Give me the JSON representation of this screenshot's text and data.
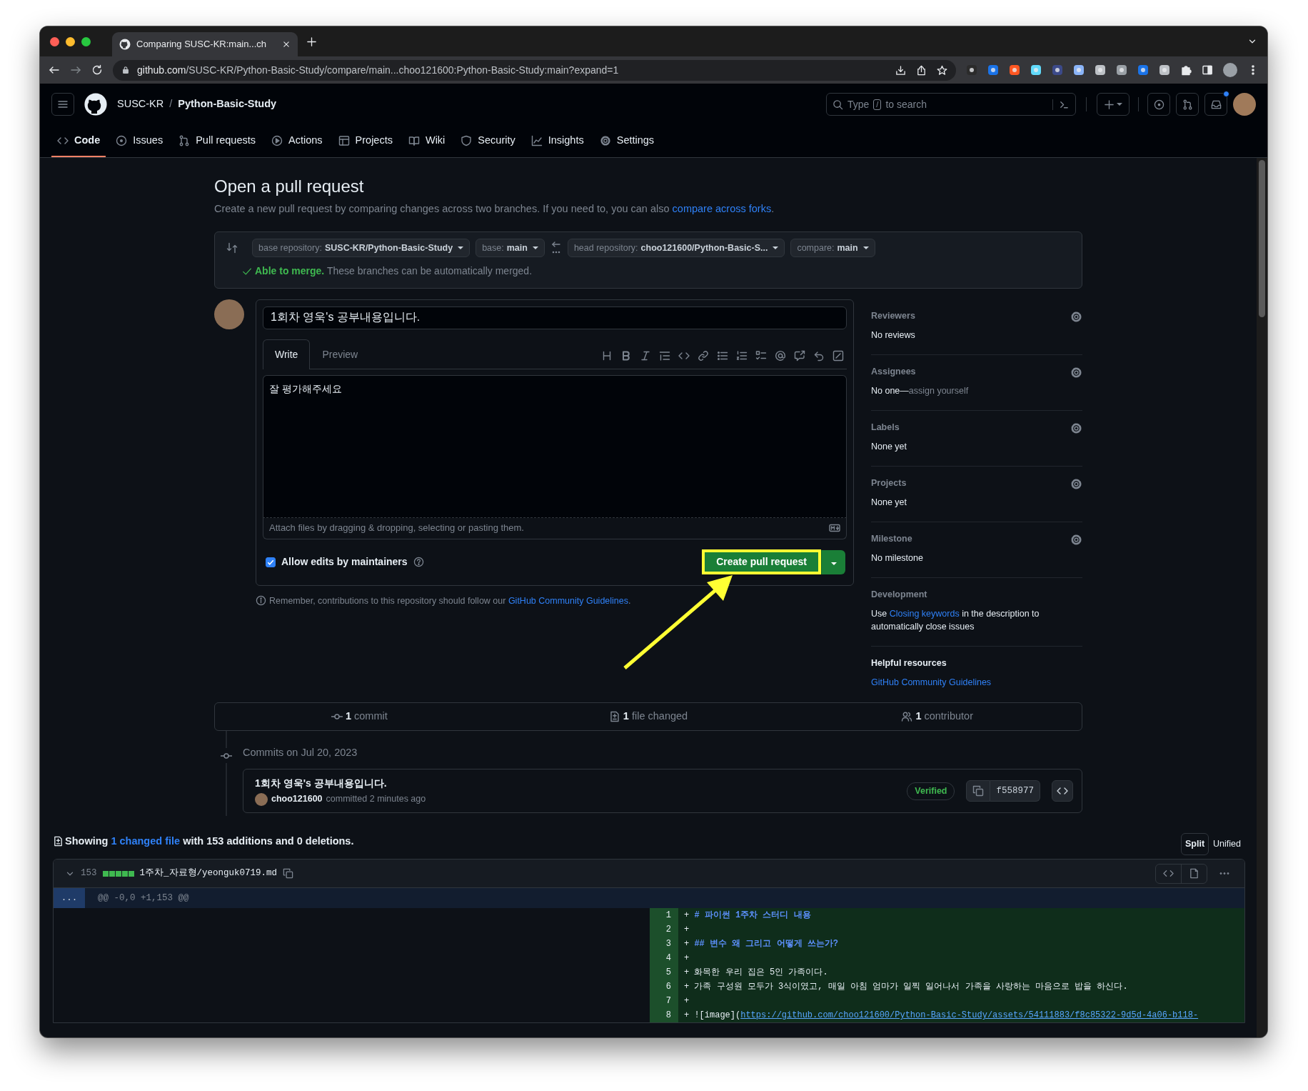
{
  "browser": {
    "tab_title": "Comparing SUSC-KR:main...ch",
    "url_host": "github.com",
    "url_path": "/SUSC-KR/Python-Basic-Study/compare/main...choo121600:Python-Basic-Study:main?expand=1"
  },
  "header": {
    "owner": "SUSC-KR",
    "separator": "/",
    "repo": "Python-Basic-Study",
    "search_before": "Type",
    "search_key": "/",
    "search_after": "to search",
    "has_notification": true
  },
  "repo_tabs": [
    {
      "label": "Code",
      "selected": true
    },
    {
      "label": "Issues",
      "selected": false
    },
    {
      "label": "Pull requests",
      "selected": false
    },
    {
      "label": "Actions",
      "selected": false
    },
    {
      "label": "Projects",
      "selected": false
    },
    {
      "label": "Wiki",
      "selected": false
    },
    {
      "label": "Security",
      "selected": false
    },
    {
      "label": "Insights",
      "selected": false
    },
    {
      "label": "Settings",
      "selected": false
    }
  ],
  "page": {
    "title": "Open a pull request",
    "description": "Create a new pull request by comparing changes across two branches. If you need to, you can also ",
    "description_link": "compare across forks",
    "description_end": "."
  },
  "compare": {
    "selectors": [
      {
        "label": "base repository:",
        "value": "SUSC-KR/Python-Basic-Study"
      },
      {
        "label": "base:",
        "value": "main"
      },
      {
        "label": "head repository:",
        "value": "choo121600/Python-Basic-S..."
      },
      {
        "label": "compare:",
        "value": "main"
      }
    ],
    "mergeable": true,
    "merge_label": "Able to merge.",
    "merge_message": "These branches can be automatically merged."
  },
  "form": {
    "title_value": "1회차 영욱's 공부내용입니다.",
    "tabs": [
      {
        "label": "Write",
        "selected": true
      },
      {
        "label": "Preview",
        "selected": false
      }
    ],
    "body_value": "잘 평가해주세요",
    "attach_hint": "Attach files by dragging & dropping, selecting or pasting them.",
    "allow_edits": {
      "label": "Allow edits by maintainers",
      "checked": true
    },
    "submit": {
      "label": "Create pull request",
      "highlighted": true
    },
    "note": "Remember, contributions to this repository should follow our ",
    "note_link": "GitHub Community Guidelines",
    "note_end": "."
  },
  "sidebar": [
    {
      "kind": "setting",
      "title": "Reviewers",
      "value": "No reviews"
    },
    {
      "kind": "setting",
      "title": "Assignees",
      "value": "No one—",
      "action": "assign yourself"
    },
    {
      "kind": "setting",
      "title": "Labels",
      "value": "None yet"
    },
    {
      "kind": "setting",
      "title": "Projects",
      "value": "None yet"
    },
    {
      "kind": "setting",
      "title": "Milestone",
      "value": "No milestone"
    },
    {
      "kind": "development",
      "title": "Development",
      "before": "Use ",
      "link": "Closing keywords",
      "after": " in the description to automatically close issues"
    },
    {
      "kind": "resources",
      "title": "Helpful resources",
      "link": "GitHub Community Guidelines"
    }
  ],
  "stats": [
    {
      "count": "1",
      "label": "commit"
    },
    {
      "count": "1",
      "label": "file changed"
    },
    {
      "count": "1",
      "label": "contributor"
    }
  ],
  "commits": {
    "date": "Commits on Jul 20, 2023",
    "items": [
      {
        "title": "1회차 영욱's 공부내용입니다.",
        "author": "choo121600",
        "action": "committed",
        "time": "2 minutes ago",
        "verified": "Verified",
        "sha": "f558977"
      }
    ]
  },
  "diff_summary": {
    "before": "Showing ",
    "link": "1 changed file",
    "after": " with 153 additions and 0 deletions."
  },
  "view_modes": [
    {
      "label": "Split",
      "selected": true
    },
    {
      "label": "Unified",
      "selected": false
    }
  ],
  "file": {
    "expanded": true,
    "changes": "153",
    "path": "1주차_자료형/yeonguk0719.md",
    "expander": "...",
    "hunk": "@@ -0,0 +1,153 @@",
    "lines": [
      {
        "number": "1",
        "sign": "+",
        "kind": "heading",
        "text": "# 파이썬 1주차 스터디 내용"
      },
      {
        "number": "2",
        "sign": "+",
        "kind": "blank"
      },
      {
        "number": "3",
        "sign": "+",
        "kind": "heading",
        "text": "## 변수 왜 그리고 어떻게 쓰는가?"
      },
      {
        "number": "4",
        "sign": "+",
        "kind": "blank"
      },
      {
        "number": "5",
        "sign": "+",
        "kind": "text",
        "text": "화목한 우리 집은 5인 가족이다."
      },
      {
        "number": "6",
        "sign": "+",
        "kind": "text",
        "text": "가족 구성원 모두가 3식이였고, 매일 아침 엄마가 일찍 일어나서 가족을 사랑하는 마음으로 밥을 하신다."
      },
      {
        "number": "7",
        "sign": "+",
        "kind": "blank"
      },
      {
        "number": "8",
        "sign": "+",
        "kind": "link",
        "text": "![image](",
        "url": "https://github.com/choo121600/Python-Basic-Study/assets/54111883/f8c85322-9d5d-4a06-b118-"
      }
    ]
  }
}
